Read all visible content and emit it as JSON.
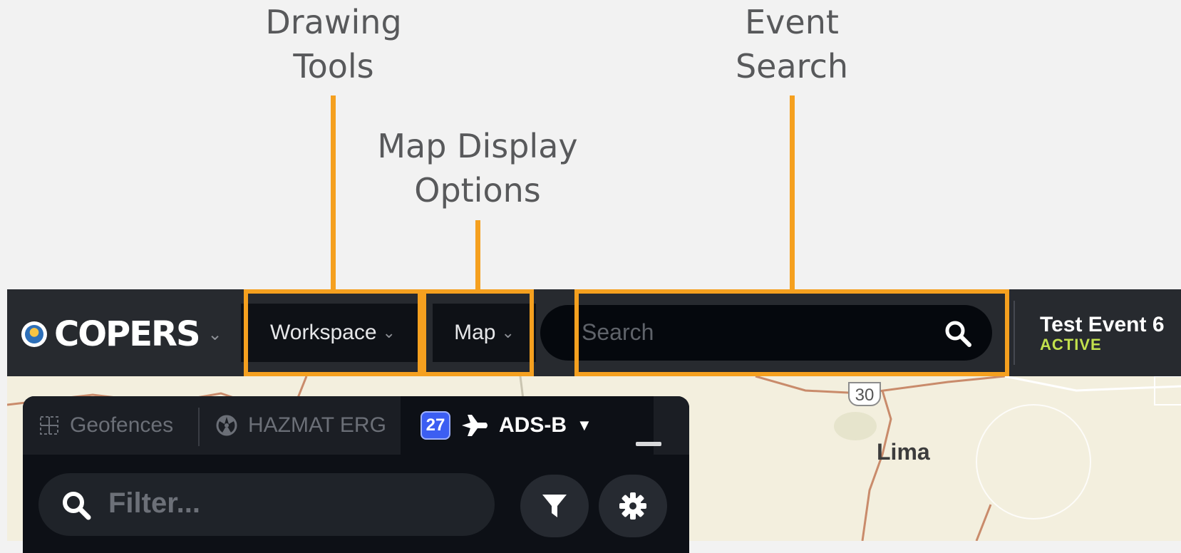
{
  "annotations": {
    "drawing_tools": [
      "Drawing",
      "Tools"
    ],
    "map_display_options": [
      "Map Display",
      "Options"
    ],
    "event_search": [
      "Event",
      "Search"
    ]
  },
  "highlight_color": "#f5a01f",
  "navbar": {
    "brand": "COPERS",
    "workspace_label": "Workspace",
    "map_label": "Map",
    "search_placeholder": "Search",
    "event_name": "Test Event 6",
    "event_status": "ACTIVE"
  },
  "map": {
    "city_label": "Lima",
    "route_number": "30"
  },
  "panel": {
    "tabs": [
      {
        "label": "Geofences",
        "icon": "geofence-grid-icon"
      },
      {
        "label": "HAZMAT ERG",
        "icon": "hazmat-icon"
      },
      {
        "label": "ADS-B",
        "icon": "airplane-icon",
        "badge": "27"
      }
    ],
    "filter_placeholder": "Filter..."
  }
}
